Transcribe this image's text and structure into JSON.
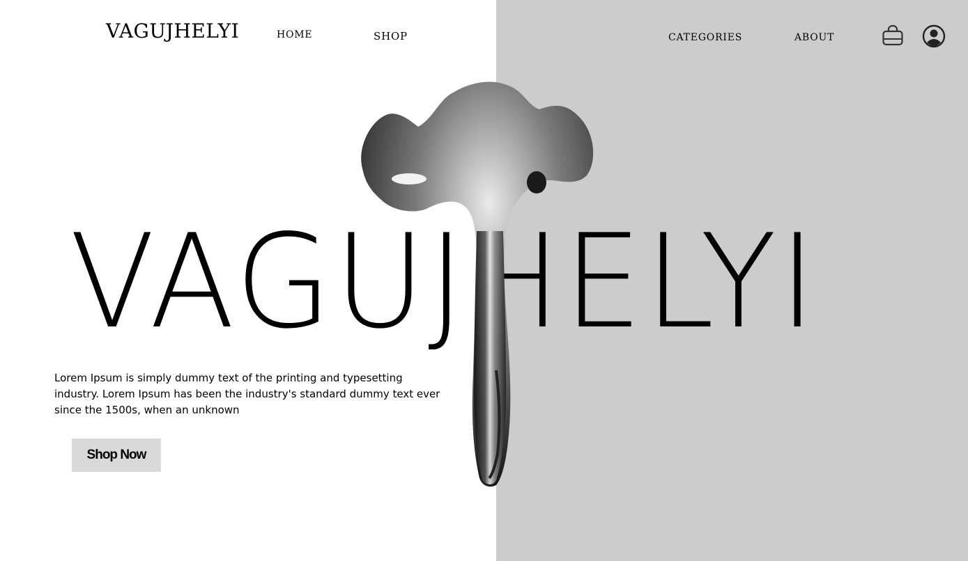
{
  "header": {
    "brand": "VAGUJHELYI",
    "nav": {
      "home": "HOME",
      "shop": "SHOP",
      "categories": "CATEGORIES",
      "about": "ABOUT"
    },
    "icons": {
      "cart": "shopping-bag-icon",
      "account": "user-circle-icon"
    }
  },
  "hero": {
    "title": "VAGUJHELYI",
    "description": "Lorem Ipsum is simply dummy text of the printing and typesetting industry. Lorem Ipsum has been the industry's standard dummy text ever since the 1500s, when an unknown",
    "cta_label": "Shop Now",
    "image": "bone-sculpture-image"
  },
  "colors": {
    "background_left": "#ffffff",
    "background_right": "#cccccc",
    "text": "#000000",
    "button_bg": "#d9d9d9"
  }
}
